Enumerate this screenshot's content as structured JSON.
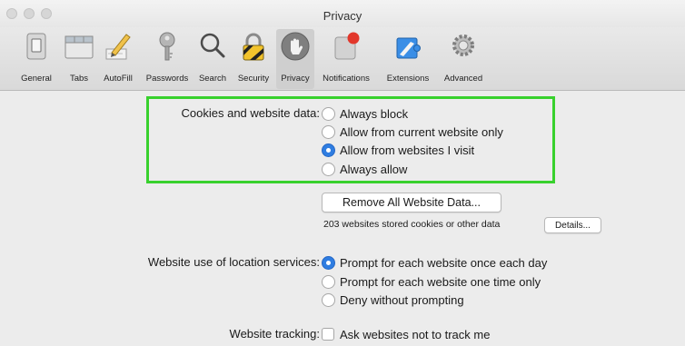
{
  "window": {
    "title": "Privacy"
  },
  "toolbar": {
    "items": [
      {
        "label": "General",
        "icon": "general-switch-icon"
      },
      {
        "label": "Tabs",
        "icon": "tabs-icon"
      },
      {
        "label": "AutoFill",
        "icon": "pencil-icon"
      },
      {
        "label": "Passwords",
        "icon": "key-icon"
      },
      {
        "label": "Search",
        "icon": "magnifier-icon"
      },
      {
        "label": "Security",
        "icon": "padlock-icon"
      },
      {
        "label": "Privacy",
        "icon": "hand-icon",
        "selected": true
      },
      {
        "label": "Notifications",
        "icon": "notification-badge-icon"
      },
      {
        "label": "Extensions",
        "icon": "puzzle-icon"
      },
      {
        "label": "Advanced",
        "icon": "gears-icon"
      }
    ]
  },
  "cookies": {
    "label": "Cookies and website data:",
    "options": [
      {
        "label": "Always block",
        "checked": false
      },
      {
        "label": "Allow from current website only",
        "checked": false
      },
      {
        "label": "Allow from websites I visit",
        "checked": true
      },
      {
        "label": "Always allow",
        "checked": false
      }
    ],
    "remove_button": "Remove All Website Data...",
    "stored_text": "203 websites stored cookies or other data",
    "details_button": "Details..."
  },
  "location": {
    "label": "Website use of location services:",
    "options": [
      {
        "label": "Prompt for each website once each day",
        "checked": true
      },
      {
        "label": "Prompt for each website one time only",
        "checked": false
      },
      {
        "label": "Deny without prompting",
        "checked": false
      }
    ]
  },
  "tracking": {
    "label": "Website tracking:",
    "checkbox_label": "Ask websites not to track me"
  },
  "colors": {
    "accent": "#2f7de1",
    "highlight": "#38d12d",
    "notification_dot": "#e2372b"
  }
}
